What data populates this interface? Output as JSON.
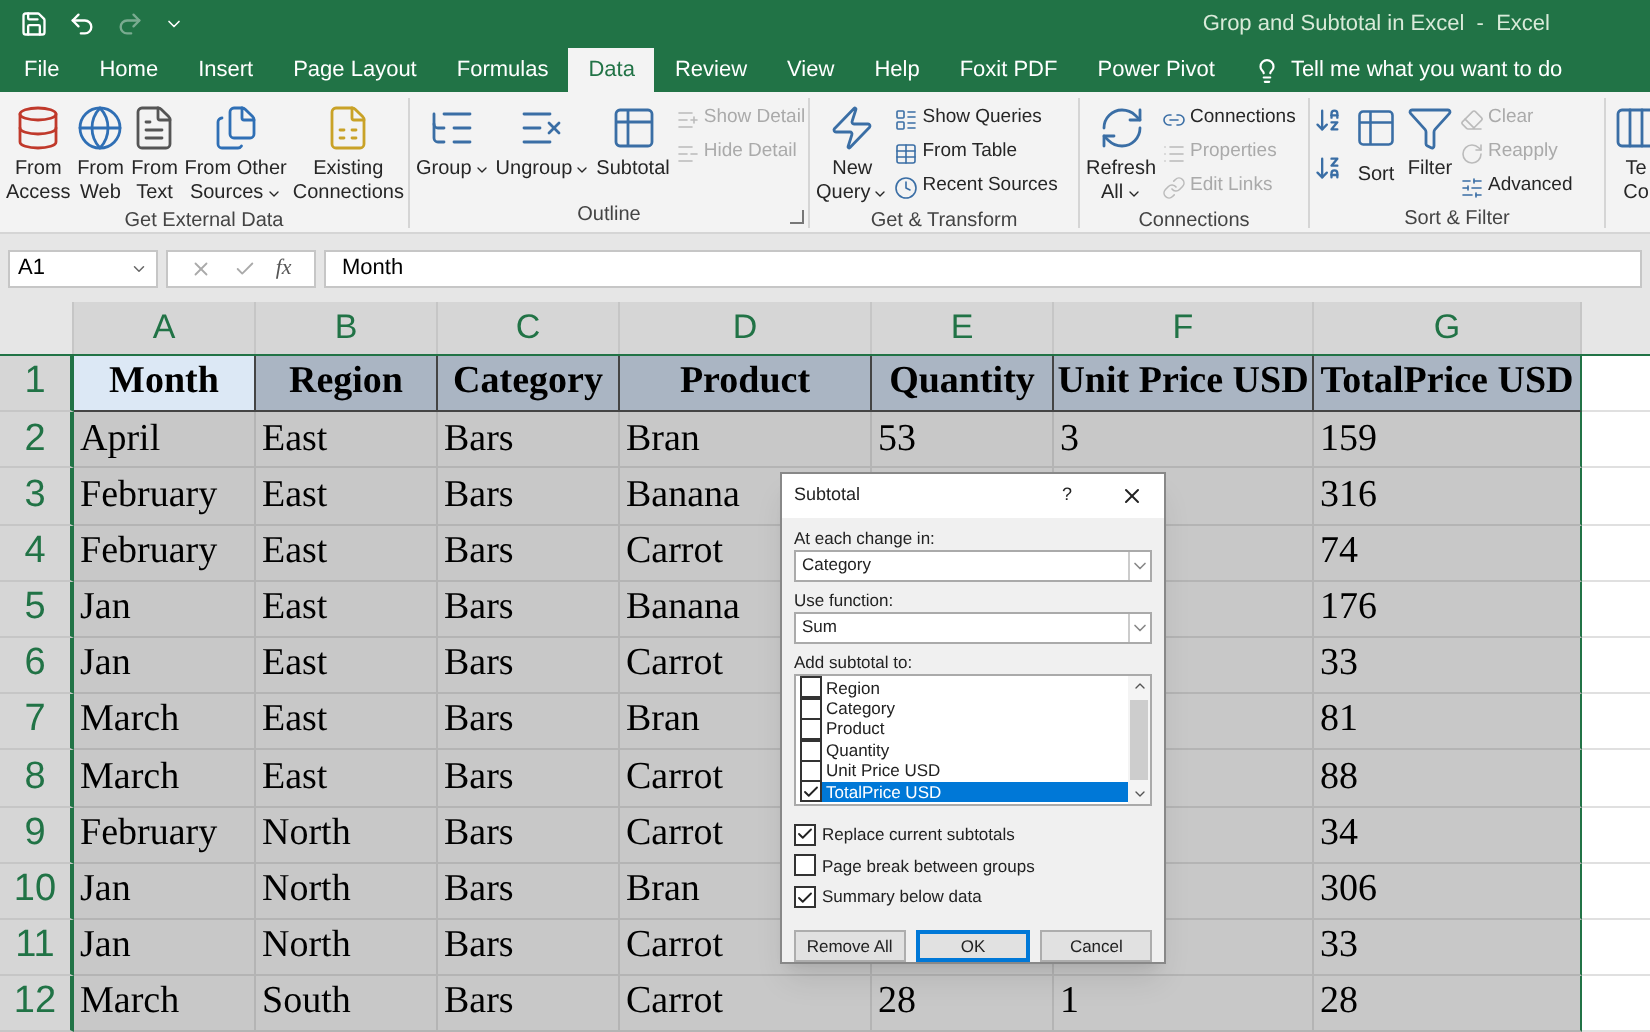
{
  "window": {
    "title": "Grop and Subtotal in Excel  -  Excel"
  },
  "quick_access": {
    "redo_disabled": true
  },
  "tabs": [
    {
      "label": "File",
      "selected": false
    },
    {
      "label": "Home",
      "selected": false
    },
    {
      "label": "Insert",
      "selected": false
    },
    {
      "label": "Page Layout",
      "selected": false
    },
    {
      "label": "Formulas",
      "selected": false
    },
    {
      "label": "Data",
      "selected": true
    },
    {
      "label": "Review",
      "selected": false
    },
    {
      "label": "View",
      "selected": false
    },
    {
      "label": "Help",
      "selected": false
    },
    {
      "label": "Foxit PDF",
      "selected": false
    },
    {
      "label": "Power Pivot",
      "selected": false
    }
  ],
  "tell_me": "Tell me what you want to do",
  "ribbon": [
    {
      "label": "Get External Data",
      "launcher": false,
      "items": [
        {
          "kind": "large",
          "lines": [
            "From",
            "Access"
          ],
          "dropdown": false,
          "disabled": false
        },
        {
          "kind": "large",
          "lines": [
            "From",
            "Web"
          ],
          "dropdown": false,
          "disabled": false
        },
        {
          "kind": "large",
          "lines": [
            "From",
            "Text"
          ],
          "dropdown": false,
          "disabled": false
        },
        {
          "kind": "large",
          "lines": [
            "From Other",
            "Sources"
          ],
          "dropdown": true,
          "disabled": false
        },
        {
          "kind": "large",
          "lines": [
            "Existing",
            "Connections"
          ],
          "dropdown": false,
          "disabled": false
        }
      ]
    },
    {
      "label": "Outline",
      "launcher": true,
      "items": [
        {
          "kind": "large",
          "lines": [
            "Group"
          ],
          "dropdown": true,
          "disabled": false
        },
        {
          "kind": "large",
          "lines": [
            "Ungroup"
          ],
          "dropdown": true,
          "disabled": false
        },
        {
          "kind": "large",
          "lines": [
            "Subtotal"
          ],
          "dropdown": false,
          "disabled": false
        },
        {
          "kind": "small",
          "lines": [
            "Show Detail"
          ],
          "dropdown": false,
          "disabled": true
        },
        {
          "kind": "small",
          "lines": [
            "Hide Detail"
          ],
          "dropdown": false,
          "disabled": true
        }
      ]
    },
    {
      "label": "Get & Transform",
      "launcher": false,
      "items": [
        {
          "kind": "large",
          "lines": [
            "New",
            "Query"
          ],
          "dropdown": true,
          "disabled": false
        },
        {
          "kind": "small",
          "lines": [
            "Show Queries"
          ],
          "dropdown": false,
          "disabled": false
        },
        {
          "kind": "small",
          "lines": [
            "From Table"
          ],
          "dropdown": false,
          "disabled": false
        },
        {
          "kind": "small",
          "lines": [
            "Recent Sources"
          ],
          "dropdown": false,
          "disabled": false
        }
      ]
    },
    {
      "label": "Connections",
      "launcher": false,
      "items": [
        {
          "kind": "large",
          "lines": [
            "Refresh",
            "All"
          ],
          "dropdown": true,
          "disabled": false
        },
        {
          "kind": "small",
          "lines": [
            "Connections"
          ],
          "dropdown": false,
          "disabled": false
        },
        {
          "kind": "small",
          "lines": [
            "Properties"
          ],
          "dropdown": false,
          "disabled": true
        },
        {
          "kind": "small",
          "lines": [
            "Edit Links"
          ],
          "dropdown": false,
          "disabled": true
        }
      ]
    },
    {
      "label": "Sort & Filter",
      "launcher": false,
      "items": [
        {
          "kind": "sort",
          "lines": [
            "Sort"
          ],
          "dropdown": false,
          "disabled": false
        },
        {
          "kind": "large",
          "lines": [
            "Filter"
          ],
          "dropdown": false,
          "disabled": false
        },
        {
          "kind": "small",
          "lines": [
            "Clear"
          ],
          "dropdown": false,
          "disabled": true
        },
        {
          "kind": "small",
          "lines": [
            "Reapply"
          ],
          "dropdown": false,
          "disabled": true
        },
        {
          "kind": "small",
          "lines": [
            "Advanced"
          ],
          "dropdown": false,
          "disabled": false
        }
      ]
    },
    {
      "items": [
        {
          "kind": "large",
          "lines": [
            "Te",
            "Co"
          ],
          "dropdown": false,
          "disabled": false
        }
      ]
    }
  ],
  "formula_bar": {
    "name_box": "A1",
    "fx": "fx",
    "value": "Month"
  },
  "sheet": {
    "columns": [
      "A",
      "B",
      "C",
      "D",
      "E",
      "F",
      "G"
    ],
    "rows": [
      {
        "number": "1",
        "kind": "header",
        "cells": [
          "Month",
          "Region",
          "Category",
          "Product",
          "Quantity",
          "Unit Price USD",
          "TotalPrice USD"
        ]
      },
      {
        "number": "2",
        "kind": "data",
        "cells": [
          "April",
          "East",
          "Bars",
          "Bran",
          "53",
          "3",
          "159"
        ]
      },
      {
        "number": "3",
        "kind": "data",
        "cells": [
          "February",
          "East",
          "Bars",
          "Banana",
          null,
          null,
          "316"
        ]
      },
      {
        "number": "4",
        "kind": "data",
        "cells": [
          "February",
          "East",
          "Bars",
          "Carrot",
          null,
          null,
          "74"
        ]
      },
      {
        "number": "5",
        "kind": "data",
        "cells": [
          "Jan",
          "East",
          "Bars",
          "Banana",
          null,
          null,
          "176"
        ]
      },
      {
        "number": "6",
        "kind": "data",
        "cells": [
          "Jan",
          "East",
          "Bars",
          "Carrot",
          null,
          null,
          "33"
        ]
      },
      {
        "number": "7",
        "kind": "data",
        "cells": [
          "March",
          "East",
          "Bars",
          "Bran",
          null,
          null,
          "81"
        ]
      },
      {
        "number": "8",
        "kind": "data",
        "cells": [
          "March",
          "East",
          "Bars",
          "Carrot",
          null,
          null,
          "88"
        ]
      },
      {
        "number": "9",
        "kind": "data",
        "cells": [
          "February",
          "North",
          "Bars",
          "Carrot",
          null,
          null,
          "34"
        ]
      },
      {
        "number": "10",
        "kind": "data",
        "cells": [
          "Jan",
          "North",
          "Bars",
          "Bran",
          null,
          null,
          "306"
        ]
      },
      {
        "number": "11",
        "kind": "data",
        "cells": [
          "Jan",
          "North",
          "Bars",
          "Carrot",
          null,
          null,
          "33"
        ]
      },
      {
        "number": "12",
        "kind": "data",
        "cells": [
          "March",
          "South",
          "Bars",
          "Carrot",
          "28",
          "1",
          "28"
        ]
      }
    ]
  },
  "dialog": {
    "title": "Subtotal",
    "help": "?",
    "change_label": "At each change in:",
    "change_value": "Category",
    "function_label": "Use function:",
    "function_value": "Sum",
    "add_label": "Add subtotal to:",
    "fields": [
      {
        "label": "Region",
        "checked": false,
        "selected": false
      },
      {
        "label": "Category",
        "checked": false,
        "selected": false
      },
      {
        "label": "Product",
        "checked": false,
        "selected": false
      },
      {
        "label": "Quantity",
        "checked": false,
        "selected": false
      },
      {
        "label": "Unit Price USD",
        "checked": false,
        "selected": false
      },
      {
        "label": "TotalPrice USD",
        "checked": true,
        "selected": true
      }
    ],
    "options": [
      {
        "label": "Replace current subtotals",
        "checked": true
      },
      {
        "label": "Page break between groups",
        "checked": false
      },
      {
        "label": "Summary below data",
        "checked": true
      }
    ],
    "buttons": [
      {
        "label": "Remove All",
        "default": false
      },
      {
        "label": "OK",
        "default": true
      },
      {
        "label": "Cancel",
        "default": false
      }
    ]
  }
}
